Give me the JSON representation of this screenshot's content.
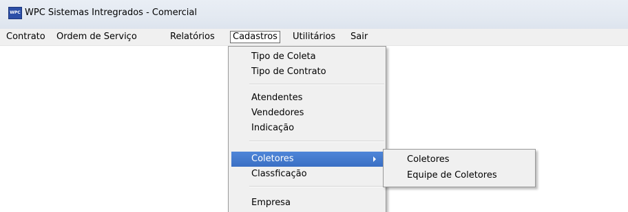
{
  "window": {
    "title": "WPC Sistemas Intregrados - Comercial",
    "icon_text": "WPC",
    "icon": "app-logo-icon"
  },
  "menubar": {
    "items": [
      {
        "label": "Contrato"
      },
      {
        "label": "Ordem de Serviço"
      },
      {
        "label": "Relatórios"
      },
      {
        "label": "Cadastros",
        "active": true
      },
      {
        "label": "Utilitários"
      },
      {
        "label": "Sair"
      }
    ]
  },
  "cadastros_menu": {
    "items": [
      {
        "label": "Tipo de Coleta"
      },
      {
        "label": "Tipo de Contrato"
      },
      {
        "label": "Atendentes"
      },
      {
        "label": "Vendedores"
      },
      {
        "label": "Indicação"
      },
      {
        "label": "Coletores",
        "highlighted": true,
        "has_submenu": true
      },
      {
        "label": "Classficação"
      },
      {
        "label": "Empresa"
      }
    ]
  },
  "coletores_submenu": {
    "items": [
      {
        "label": "Coletores"
      },
      {
        "label": "Equipe de Coletores"
      }
    ]
  },
  "colors": {
    "highlight": "#3a6fc4",
    "menu_background": "#f0f0f0",
    "titlebar": "#e3e9f1"
  }
}
